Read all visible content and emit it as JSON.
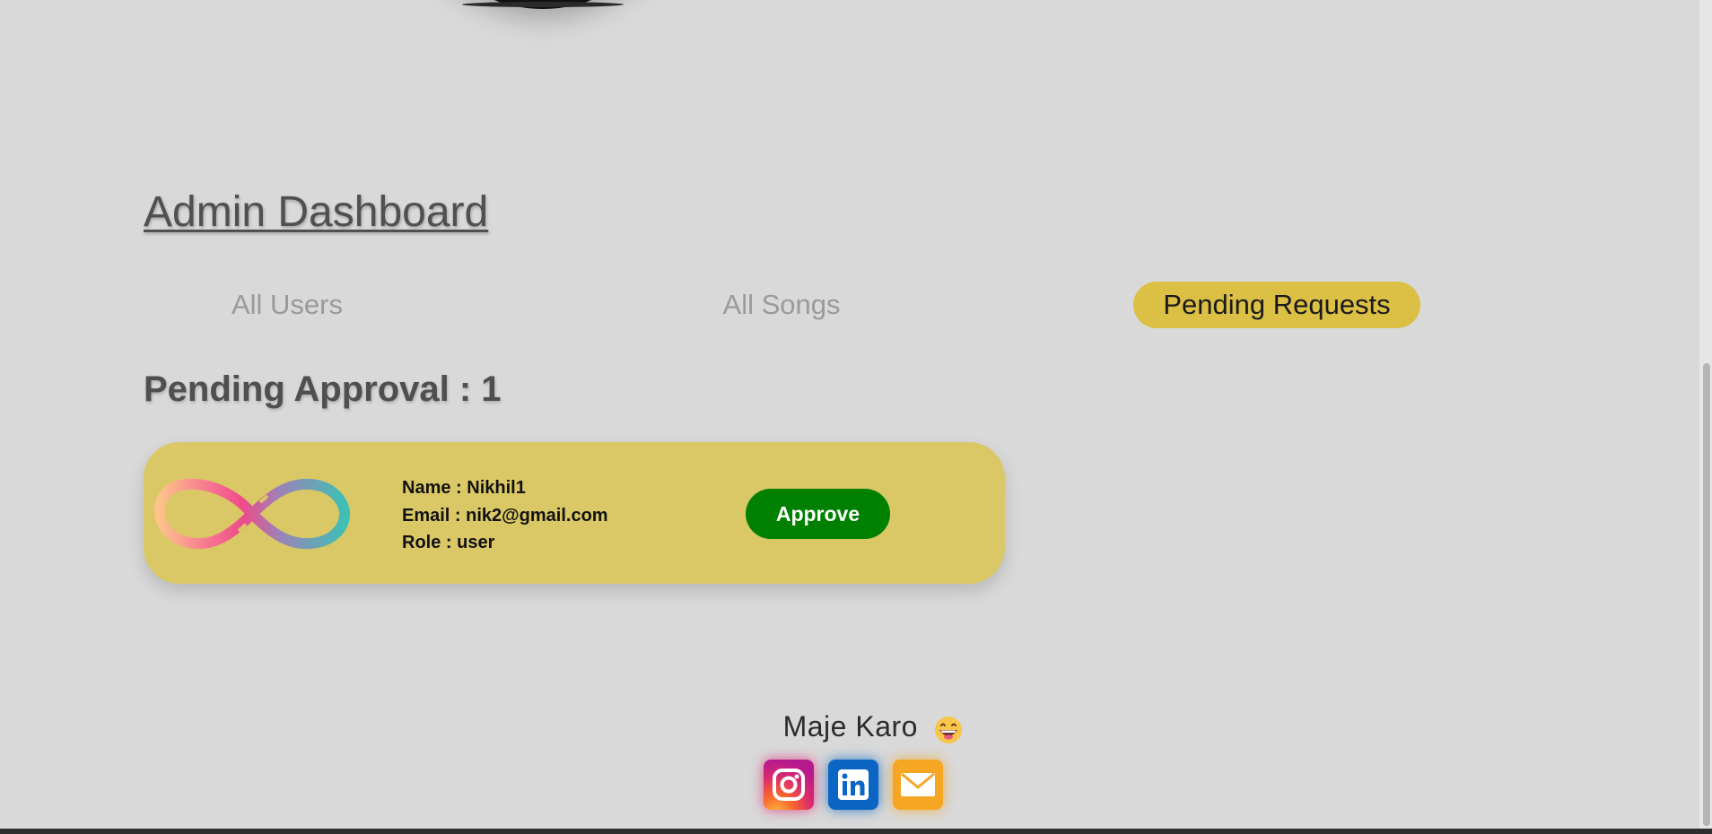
{
  "dashboard": {
    "title": "Admin Dashboard"
  },
  "tabs": [
    {
      "label": "All Users",
      "active": false
    },
    {
      "label": "All Songs",
      "active": false
    },
    {
      "label": "Pending Requests",
      "active": true
    }
  ],
  "pending": {
    "heading": "Pending Approval : 1",
    "requests": [
      {
        "name_line": "Name : Nikhil1",
        "email_line": "Email : nik2@gmail.com",
        "role_line": "Role : user",
        "approve_label": "Approve",
        "logo_icon": "infinity-logo-icon"
      }
    ]
  },
  "footer": {
    "brand": "Maje Karo",
    "emoji_icon": "grinning-face-emoji-icon",
    "social": [
      {
        "icon": "instagram-icon",
        "color": "#d92a6e"
      },
      {
        "icon": "linkedin-icon",
        "color": "#0a66c2"
      },
      {
        "icon": "mail-icon",
        "color": "#f5a623"
      }
    ]
  },
  "colors": {
    "background": "#d9d9d9",
    "accent_yellow": "#dcbf45",
    "card_yellow": "#dac866",
    "approve_green": "#008000",
    "heading_gray": "#505050",
    "tab_inactive": "#9a9a9a"
  }
}
